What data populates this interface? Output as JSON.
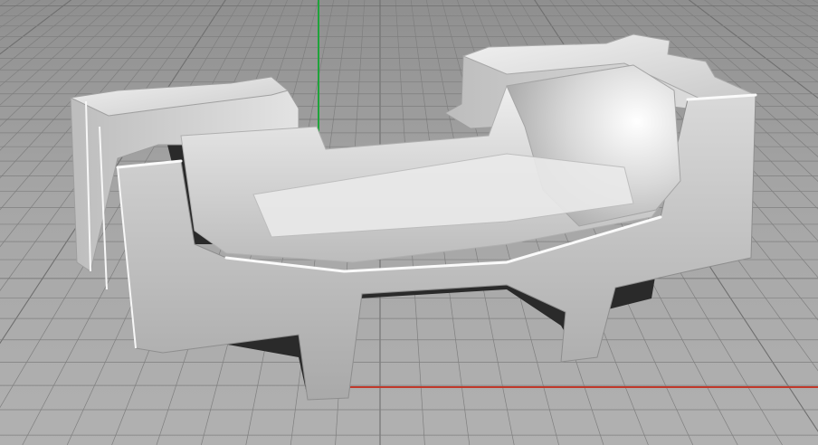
{
  "viewport": {
    "view": "perspective",
    "background_color": "#9c9c9c",
    "grid_color": "#7f7f7f",
    "grid_major_color": "#6f6f6f",
    "x_axis_color": "#c0392b",
    "y_axis_color": "#1fa33a",
    "model_color": "#d4d4d4",
    "model_shadow_color": "#2a2a2a",
    "shading": "shaded"
  }
}
